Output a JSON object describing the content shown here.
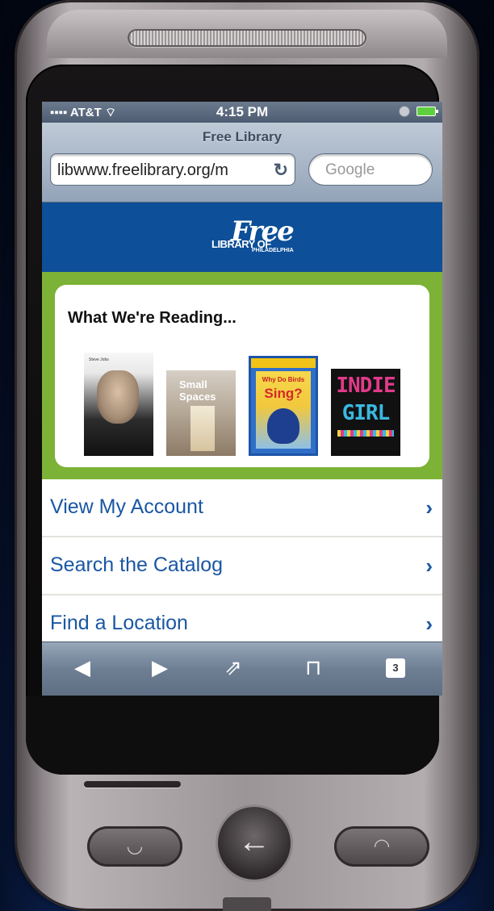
{
  "status_bar": {
    "carrier": "AT&T",
    "signal_glyph": "▪▪▪▪",
    "wifi_glyph": "☰",
    "time": "4:15 PM"
  },
  "browser": {
    "page_title": "Free Library",
    "url": "libwww.freelibrary.org/m",
    "search_placeholder": "Google",
    "reload_glyph": "↻",
    "tabs_count": "3"
  },
  "site": {
    "logo_free": "Free",
    "logo_library": "LIBRARY OF",
    "logo_city": "PHILADELPHIA",
    "featured_title": "What We're Reading...",
    "books": [
      {
        "cover_text": "Steve Jobs",
        "icon": "book-cover-steve-jobs"
      },
      {
        "cover_text": "Small Spaces",
        "icon": "book-cover-small-spaces"
      },
      {
        "cover_text_top": "Why Do Birds",
        "cover_text_main": "Sing?",
        "icon": "book-cover-why-do-birds-sing"
      },
      {
        "cover_text_top": "INDIE",
        "cover_text_main": "GIRL",
        "icon": "book-cover-indie-girl"
      }
    ],
    "nav_items": [
      {
        "label": "View My Account"
      },
      {
        "label": "Search the Catalog"
      },
      {
        "label": "Find a Location"
      }
    ]
  },
  "toolbar": {
    "back_glyph": "◀",
    "forward_glyph": "▶",
    "share_glyph": "⇗",
    "bookmarks_glyph": "📖"
  },
  "hardware": {
    "back_glyph": "←"
  },
  "colors": {
    "header_blue": "#0d4f98",
    "accent_green": "#7cb236",
    "link_blue": "#1a57a3"
  }
}
